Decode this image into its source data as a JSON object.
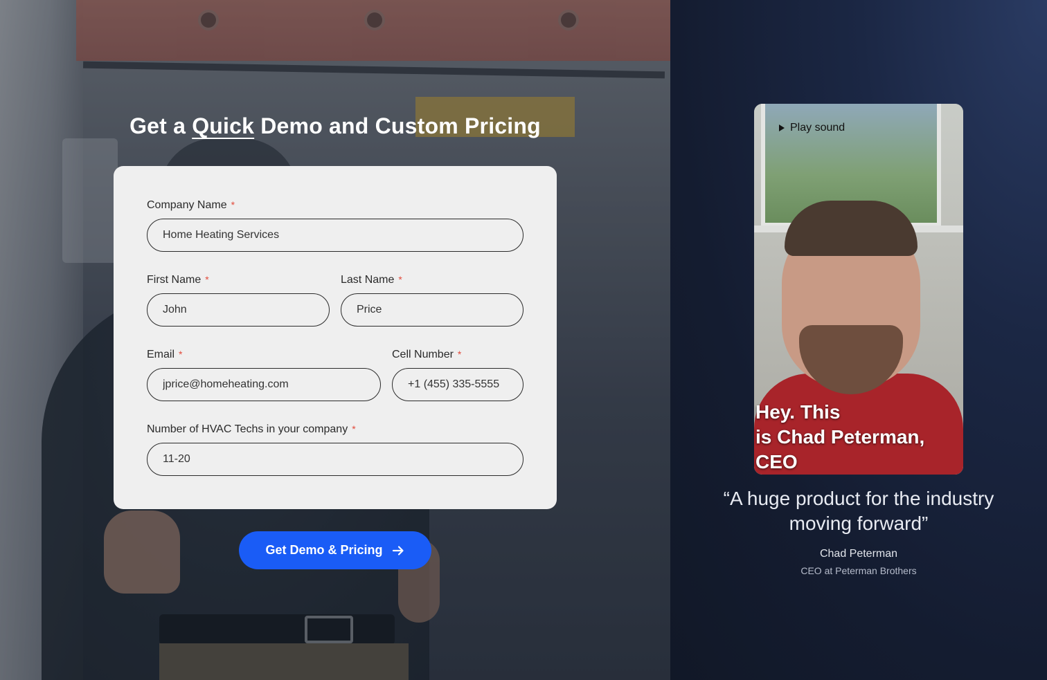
{
  "headline": {
    "prefix": "Get a ",
    "emphasis": "Quick",
    "suffix": " Demo and Custom Pricing"
  },
  "form": {
    "company": {
      "label": "Company Name",
      "required": "*",
      "value": "Home Heating Services"
    },
    "first_name": {
      "label": "First Name",
      "required": "*",
      "value": "John"
    },
    "last_name": {
      "label": "Last Name",
      "required": "*",
      "value": "Price"
    },
    "email": {
      "label": "Email",
      "required": "*",
      "value": "jprice@homeheating.com"
    },
    "cell": {
      "label": "Cell Number",
      "required": "*",
      "value": "+1 (455) 335-5555"
    },
    "techs": {
      "label": "Number of HVAC Techs in your company",
      "required": "*",
      "value": "11-20"
    },
    "submit_label": "Get Demo & Pricing"
  },
  "testimonial": {
    "play_sound_label": "Play sound",
    "caption_line1": "Hey. This",
    "caption_line2": "is Chad Peterman,",
    "caption_line3": "CEO",
    "quote_line1": "“A huge product for the industry",
    "quote_line2": "moving forward”",
    "name": "Chad Peterman",
    "role": "CEO at Peterman Brothers"
  },
  "colors": {
    "accent": "#1a5cf6",
    "required": "#e24a3b",
    "panel_dark": "#141c30"
  }
}
